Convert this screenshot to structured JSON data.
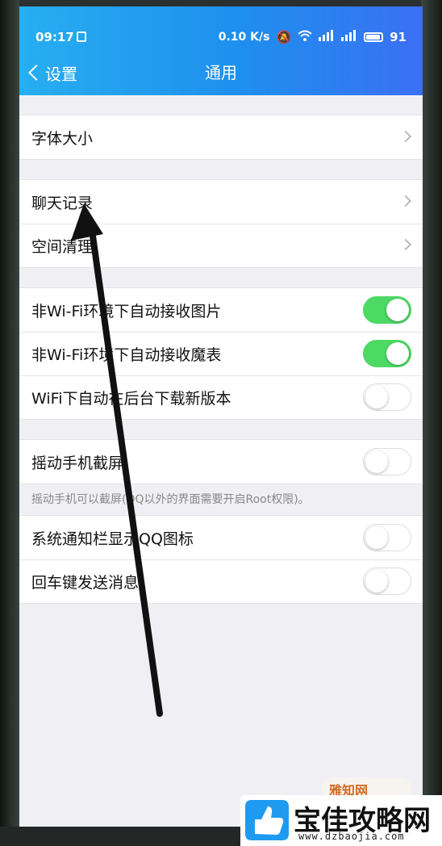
{
  "status_bar": {
    "time": "09:17",
    "speed": "0.10 K/s",
    "battery": "91"
  },
  "nav": {
    "back_label": "设置",
    "title": "通用"
  },
  "groups": [
    {
      "rows": [
        {
          "label": "字体大小",
          "type": "arrow"
        }
      ]
    },
    {
      "rows": [
        {
          "label": "聊天记录",
          "type": "arrow"
        },
        {
          "label": "空间清理",
          "type": "arrow"
        }
      ]
    },
    {
      "rows": [
        {
          "label": "非Wi-Fi环境下自动接收图片",
          "type": "toggle",
          "on": true
        },
        {
          "label": "非Wi-Fi环境下自动接收魔表",
          "type": "toggle",
          "on": true
        },
        {
          "label": "WiFi下自动在后台下载新版本",
          "type": "toggle",
          "on": false
        }
      ]
    },
    {
      "rows": [
        {
          "label": "摇动手机截屏",
          "type": "toggle",
          "on": false
        }
      ],
      "note": "摇动手机可以截屏(QQ以外的界面需要开启Root权限)。"
    },
    {
      "rows": [
        {
          "label": "系统通知栏显示QQ图标",
          "type": "toggle",
          "on": false
        },
        {
          "label": "回车键发送消息",
          "type": "toggle",
          "on": false
        }
      ]
    }
  ],
  "watermark": {
    "small": "雅知网",
    "title": "宝佳攻略网",
    "url": "www.dzbaojia.com"
  },
  "colors": {
    "header_start": "#27aef0",
    "header_end": "#3b6ff2",
    "toggle_on": "#4cd964",
    "background": "#f0f0f4"
  }
}
